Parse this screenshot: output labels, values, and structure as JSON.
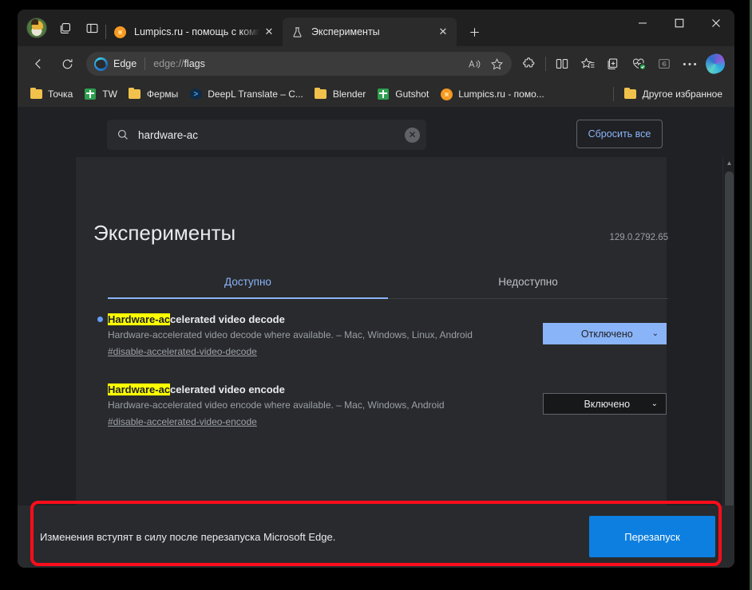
{
  "window": {
    "tabs": [
      {
        "title": "Lumpics.ru - помощь с компьюте",
        "icon": "orange-favicon",
        "active": false
      },
      {
        "title": "Эксперименты",
        "icon": "flask-icon",
        "active": true
      }
    ],
    "new_tab_label": "+",
    "controls": {
      "minimize": "—",
      "maximize": "☐",
      "close": "✕"
    }
  },
  "toolbar": {
    "back_icon": "arrow-left-icon",
    "refresh_icon": "refresh-icon",
    "brand_label": "Edge",
    "url_scheme": "edge://",
    "url_path": "flags",
    "read_aloud_icon": "read-aloud-icon",
    "favorite_icon": "star-icon",
    "extensions_icon": "puzzle-icon",
    "split_screen_icon": "split-screen-icon",
    "favorites_icon": "favorites-star-icon",
    "collections_icon": "collections-icon",
    "browser_essentials_icon": "heart-pulse-icon",
    "ie_mode_icon": "internet-explorer-icon",
    "settings_icon": "ellipsis-icon",
    "copilot_icon": "copilot-icon"
  },
  "bookmarks": {
    "items": [
      {
        "label": "Точка",
        "icon": "folder-icon"
      },
      {
        "label": "TW",
        "icon": "green-square-icon"
      },
      {
        "label": "Фермы",
        "icon": "folder-icon"
      },
      {
        "label": "DeepL Translate – C...",
        "icon": "deepl-icon"
      },
      {
        "label": "Blender",
        "icon": "folder-icon"
      },
      {
        "label": "Gutshot",
        "icon": "green-square-icon"
      },
      {
        "label": "Lumpics.ru - помо...",
        "icon": "orange-favicon"
      }
    ],
    "other_favorites": {
      "label": "Другое избранное",
      "icon": "folder-icon"
    }
  },
  "search": {
    "icon": "search-icon",
    "value": "hardware-ac",
    "clear_icon": "clear-icon",
    "reset_all_label": "Сбросить все"
  },
  "page": {
    "title": "Эксперименты",
    "version": "129.0.2792.65",
    "tabs": [
      {
        "label": "Доступно",
        "active": true
      },
      {
        "label": "Недоступно",
        "active": false
      }
    ],
    "flags": [
      {
        "name_highlight": "Hardware-ac",
        "name_rest": "celerated video decode",
        "description": "Hardware-accelerated video decode where available. – Mac, Windows, Linux, Android",
        "link": "#disable-accelerated-video-decode",
        "value": "Отключено",
        "modified": true,
        "chevron": "⌄"
      },
      {
        "name_highlight": "Hardware-ac",
        "name_rest": "celerated video encode",
        "description": "Hardware-accelerated video encode where available. – Mac, Windows, Android",
        "link": "#disable-accelerated-video-encode",
        "value": "Включено",
        "modified": false,
        "chevron": "⌄"
      }
    ]
  },
  "restart_bar": {
    "message": "Изменения вступят в силу после перезапуска Microsoft Edge.",
    "button_label": "Перезапуск"
  },
  "scrollbar": {
    "up_arrow": "▲"
  },
  "colors": {
    "accent_blue": "#8ab4f8",
    "restart_blue": "#0d7fe0",
    "highlight_yellow": "#ffff00",
    "annotation_red": "#fc0d1b",
    "page_bg": "#202124",
    "card_bg": "#292a2d"
  }
}
